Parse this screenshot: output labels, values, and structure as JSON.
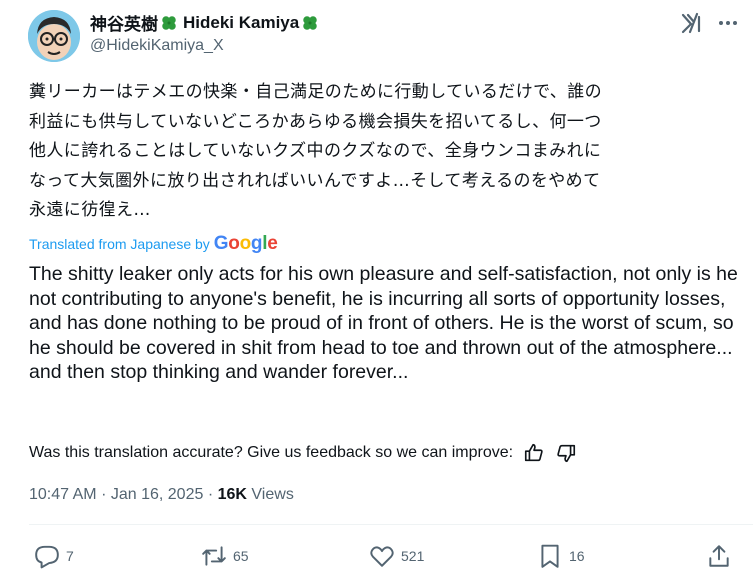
{
  "author": {
    "name": "神谷英樹",
    "name_en": "Hideki Kamiya",
    "handle": "@HidekiKamiya_X"
  },
  "post": {
    "text_original": "糞リーカーはテメエの快楽・自己満足のために行動しているだけで、誰の\n利益にも供与していないどころかあらゆる機会損失を招いてるし、何一つ\n他人に誇れることはしていないクズ中のクズなので、全身ウンコまみれに\nなって大気圏外に放り出されればいいんですよ…そして考えるのをやめて\n永遠に彷徨え…",
    "translated_label": "Translated from Japanese by",
    "translator": "Google",
    "text_translated": "The shitty leaker only acts for his own pleasure and self-satisfaction, not only is he not contributing to anyone's benefit, he is incurring all sorts of opportunity losses, and has done nothing to be proud of in front of others. He is the worst of scum, so he should be covered in shit from head to toe and thrown out of the atmosphere... and then stop thinking and wander forever...",
    "feedback_prompt": "Was this translation accurate? Give us feedback so we can improve:"
  },
  "meta": {
    "time": "10:47 AM",
    "date": "Jan 16, 2025",
    "sep": "·",
    "views_count": "16K",
    "views_label": "Views"
  },
  "actions": {
    "replies": "7",
    "reposts": "65",
    "likes": "521",
    "bookmarks": "16"
  },
  "icons": [
    "avatar",
    "clover-icon",
    "grok-icon",
    "more-icon",
    "google-logo",
    "thumbs-up-icon",
    "thumbs-down-icon",
    "reply-icon",
    "repost-icon",
    "like-icon",
    "bookmark-icon",
    "share-icon"
  ],
  "colors": {
    "link": "#1d9bf0",
    "secondary_text": "#536471",
    "clover": "#2e9b3c"
  }
}
